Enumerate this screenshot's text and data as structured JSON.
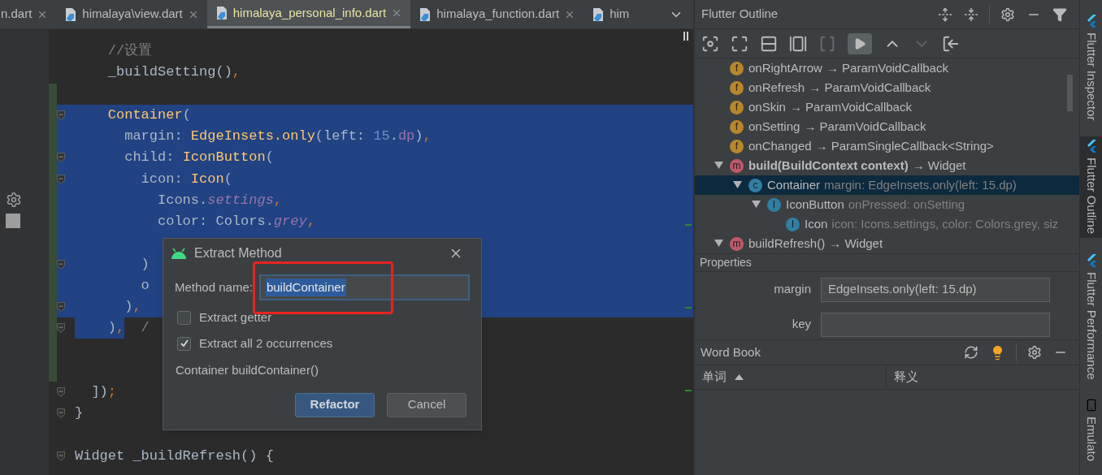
{
  "editor_tabs": [
    {
      "label": "n.dart",
      "selected": false,
      "closable": true
    },
    {
      "label": "himalaya\\view.dart",
      "selected": false,
      "closable": true
    },
    {
      "label": "himalaya_personal_info.dart",
      "selected": true,
      "closable": true
    },
    {
      "label": "himalaya_function.dart",
      "selected": false,
      "closable": true
    },
    {
      "label": "him",
      "selected": false,
      "closable": false
    }
  ],
  "code_lines": [
    {
      "changed": false,
      "fold": false,
      "selected": false,
      "tokens": [
        {
          "kind": "comment",
          "text": "    //设置"
        }
      ]
    },
    {
      "changed": false,
      "fold": false,
      "selected": false,
      "tokens": [
        {
          "kind": "plain",
          "text": "    _buildSetting()"
        },
        {
          "kind": "punct",
          "text": ","
        }
      ]
    },
    {
      "changed": true,
      "fold": false,
      "selected": false
    },
    {
      "changed": true,
      "fold": true,
      "selected": true,
      "tokens": [
        {
          "kind": "call",
          "text": "    Container"
        },
        {
          "kind": "plain",
          "text": "("
        }
      ]
    },
    {
      "changed": true,
      "fold": false,
      "selected": true,
      "tokens": [
        {
          "kind": "plain",
          "text": "      margin: "
        },
        {
          "kind": "call",
          "text": "EdgeInsets.only"
        },
        {
          "kind": "plain",
          "text": "(left: "
        },
        {
          "kind": "number",
          "text": "15"
        },
        {
          "kind": "plain",
          "text": "."
        },
        {
          "kind": "ext",
          "text": "dp"
        },
        {
          "kind": "plain",
          "text": ")"
        },
        {
          "kind": "punct",
          "text": ","
        }
      ]
    },
    {
      "changed": true,
      "fold": true,
      "selected": true,
      "tokens": [
        {
          "kind": "plain",
          "text": "      child: "
        },
        {
          "kind": "call",
          "text": "IconButton"
        },
        {
          "kind": "plain",
          "text": "("
        }
      ]
    },
    {
      "changed": true,
      "fold": true,
      "selected": true,
      "tokens": [
        {
          "kind": "plain",
          "text": "        icon: "
        },
        {
          "kind": "call",
          "text": "Icon"
        },
        {
          "kind": "plain",
          "text": "("
        }
      ]
    },
    {
      "changed": true,
      "fold": false,
      "selected": true,
      "tokens": [
        {
          "kind": "plain",
          "text": "          Icons."
        },
        {
          "kind": "field",
          "text": "settings"
        },
        {
          "kind": "punct",
          "text": ","
        }
      ]
    },
    {
      "changed": true,
      "fold": false,
      "selected": true,
      "tokens": [
        {
          "kind": "plain",
          "text": "          color: Colors."
        },
        {
          "kind": "field",
          "text": "grey"
        },
        {
          "kind": "punct",
          "text": ","
        }
      ]
    },
    {
      "changed": true,
      "fold": false,
      "selected": true
    },
    {
      "changed": true,
      "fold": true,
      "selected": true,
      "tokens": [
        {
          "kind": "plain",
          "text": "        )"
        }
      ]
    },
    {
      "changed": true,
      "fold": false,
      "selected": true,
      "tokens": [
        {
          "kind": "plain",
          "text": "        o"
        }
      ]
    },
    {
      "changed": true,
      "fold": true,
      "selected": true,
      "tokens": [
        {
          "kind": "plain",
          "text": "      )"
        },
        {
          "kind": "punct",
          "text": ","
        }
      ]
    },
    {
      "changed": true,
      "fold": true,
      "selected": false,
      "tokens": [
        {
          "kind": "plain",
          "text": "    )",
          "selected": true
        },
        {
          "kind": "punct",
          "text": ",",
          "selected": true
        },
        {
          "kind": "comment",
          "text": "  /"
        }
      ]
    },
    {
      "changed": true,
      "fold": false,
      "selected": false
    },
    {
      "changed": true,
      "fold": false,
      "selected": false
    },
    {
      "changed": false,
      "fold": true,
      "selected": false,
      "tokens": [
        {
          "kind": "plain",
          "text": "  ])"
        },
        {
          "kind": "punct",
          "text": ";"
        }
      ]
    },
    {
      "changed": false,
      "fold": true,
      "selected": false,
      "tokens": [
        {
          "kind": "plain",
          "text": "}"
        }
      ]
    },
    {
      "changed": false,
      "fold": false,
      "selected": false
    },
    {
      "changed": false,
      "fold": true,
      "selected": false,
      "tokens": [
        {
          "kind": "plain",
          "text": "Widget _buildRefresh() {"
        }
      ]
    }
  ],
  "dialog": {
    "title": "Extract Method",
    "name_label": "Method name:",
    "name_value": "buildContainer",
    "options": [
      {
        "label": "Extract getter",
        "checked": false
      },
      {
        "label": "Extract all 2 occurrences",
        "checked": true
      }
    ],
    "signature": "Container buildContainer()",
    "buttons": [
      {
        "label": "Refactor",
        "primary": true
      },
      {
        "label": "Cancel",
        "primary": false
      }
    ]
  },
  "outline": {
    "title": "Flutter Outline",
    "tree": [
      {
        "kind": "field",
        "badge": "f",
        "label": "onRightArrow",
        "returns": "→ ParamVoidCallback",
        "selected": false
      },
      {
        "kind": "field",
        "badge": "f",
        "label": "onRefresh",
        "returns": "→ ParamVoidCallback",
        "selected": false
      },
      {
        "kind": "field",
        "badge": "f",
        "label": "onSkin",
        "returns": "→ ParamVoidCallback",
        "selected": false
      },
      {
        "kind": "field",
        "badge": "f",
        "label": "onSetting",
        "returns": "→ ParamVoidCallback",
        "selected": false
      },
      {
        "kind": "field",
        "badge": "f",
        "label": "onChanged",
        "returns": "→ ParamSingleCallback<String>",
        "selected": false
      },
      {
        "kind": "method",
        "badge": "m",
        "label": "build(BuildContext context)",
        "bold": true,
        "returns": "→ Widget",
        "expanded": true,
        "selected": false,
        "children": [
          {
            "kind": "class",
            "badge": "c",
            "label": "Container",
            "detail": "margin: EdgeInsets.only(left: 15.dp)",
            "expanded": true,
            "selected": true,
            "children": [
              {
                "kind": "instance",
                "badge": "I",
                "label": "IconButton",
                "detail": "onPressed: onSetting",
                "expanded": true,
                "selected": false,
                "children": [
                  {
                    "kind": "instance",
                    "badge": "I",
                    "label": "Icon",
                    "detail": "icon: Icons.settings, color: Colors.grey, siz",
                    "selected": false
                  }
                ]
              }
            ]
          }
        ]
      },
      {
        "kind": "method",
        "badge": "m",
        "label": "buildRefresh()",
        "bold": false,
        "returns": "→ Widget",
        "expanded": true,
        "selected": false
      }
    ]
  },
  "properties": {
    "title": "Properties",
    "rows": [
      {
        "label": "margin",
        "value": "EdgeInsets.only(left: 15.dp)"
      },
      {
        "label": "key"
      }
    ]
  },
  "word_book": {
    "title": "Word Book",
    "columns": [
      {
        "label": "单词",
        "sorted": true
      },
      {
        "label": "释义",
        "sorted": false
      }
    ]
  },
  "side_tabs": [
    {
      "label": "Flutter Inspector",
      "selected": false
    },
    {
      "label": "Flutter Outline",
      "selected": true
    },
    {
      "label": "Flutter Performance",
      "selected": false
    },
    {
      "label": "Emulato",
      "selected": false,
      "kind": "device"
    }
  ]
}
